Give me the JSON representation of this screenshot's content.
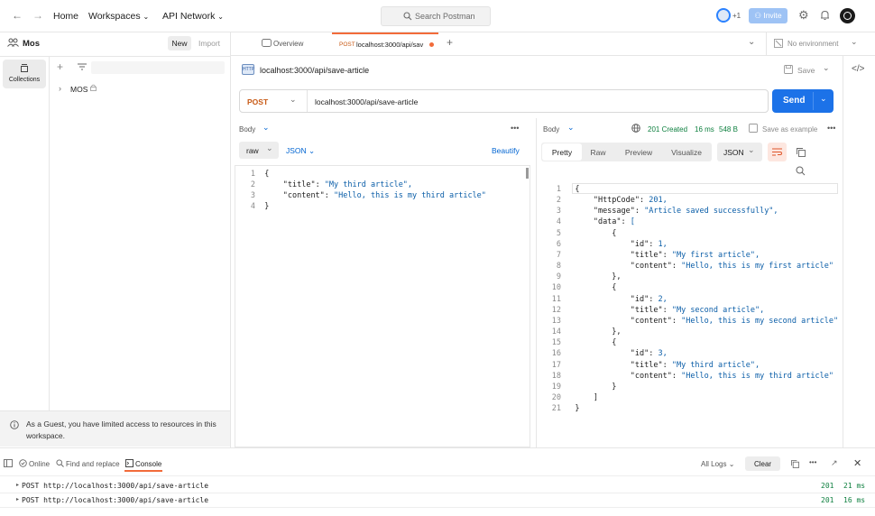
{
  "topbar": {
    "home": "Home",
    "workspaces": "Workspaces",
    "api_network": "API Network",
    "search_placeholder": "Search Postman",
    "plus_one": "+1",
    "invite": "Invite"
  },
  "sidebar": {
    "workspace_name": "Mos",
    "new_btn": "New",
    "import_btn": "Import",
    "collections_label": "Collections",
    "tree_item": "MOS",
    "guest_notice": "As a Guest, you have limited access to resources in this workspace."
  },
  "tabs": {
    "overview": "Overview",
    "active_method": "POST",
    "active_url": "localhost:3000/api/sav",
    "env": "No environment"
  },
  "request": {
    "title": "localhost:3000/api/save-article",
    "save": "Save",
    "method": "POST",
    "url": "localhost:3000/api/save-article",
    "send": "Send",
    "body_label": "Body",
    "raw": "raw",
    "json": "JSON",
    "beautify": "Beautify",
    "body_lines": [
      {
        "n": "1",
        "t": "{"
      },
      {
        "n": "2",
        "k": "\"title\"",
        "v": "\"My third article\","
      },
      {
        "n": "3",
        "k": "\"content\"",
        "v": "\"Hello, this is my third article\""
      },
      {
        "n": "4",
        "t": "}"
      }
    ]
  },
  "response": {
    "body_label": "Body",
    "status": "201 Created",
    "time": "16 ms",
    "size": "548 B",
    "save_example": "Save as example",
    "tabs": [
      "Pretty",
      "Raw",
      "Preview",
      "Visualize"
    ],
    "format": "JSON",
    "lines": [
      {
        "n": "1",
        "i": 0,
        "t": "{"
      },
      {
        "n": "2",
        "i": 1,
        "k": "\"HttpCode\"",
        "v": "201,"
      },
      {
        "n": "3",
        "i": 1,
        "k": "\"message\"",
        "v": "\"Article saved successfully\","
      },
      {
        "n": "4",
        "i": 1,
        "k": "\"data\"",
        "v": "["
      },
      {
        "n": "5",
        "i": 2,
        "t": "{"
      },
      {
        "n": "6",
        "i": 3,
        "k": "\"id\"",
        "v": "1,"
      },
      {
        "n": "7",
        "i": 3,
        "k": "\"title\"",
        "v": "\"My first article\","
      },
      {
        "n": "8",
        "i": 3,
        "k": "\"content\"",
        "v": "\"Hello, this is my first article\""
      },
      {
        "n": "9",
        "i": 2,
        "t": "},"
      },
      {
        "n": "10",
        "i": 2,
        "t": "{"
      },
      {
        "n": "11",
        "i": 3,
        "k": "\"id\"",
        "v": "2,"
      },
      {
        "n": "12",
        "i": 3,
        "k": "\"title\"",
        "v": "\"My second article\","
      },
      {
        "n": "13",
        "i": 3,
        "k": "\"content\"",
        "v": "\"Hello, this is my second article\""
      },
      {
        "n": "14",
        "i": 2,
        "t": "},"
      },
      {
        "n": "15",
        "i": 2,
        "t": "{"
      },
      {
        "n": "16",
        "i": 3,
        "k": "\"id\"",
        "v": "3,"
      },
      {
        "n": "17",
        "i": 3,
        "k": "\"title\"",
        "v": "\"My third article\","
      },
      {
        "n": "18",
        "i": 3,
        "k": "\"content\"",
        "v": "\"Hello, this is my third article\""
      },
      {
        "n": "19",
        "i": 2,
        "t": "}"
      },
      {
        "n": "20",
        "i": 1,
        "t": "]"
      },
      {
        "n": "21",
        "i": 0,
        "t": "}"
      }
    ]
  },
  "footer": {
    "online": "Online",
    "find_replace": "Find and replace",
    "console": "Console",
    "all_logs": "All Logs",
    "clear": "Clear"
  },
  "console_logs": [
    {
      "text": "POST http://localhost:3000/api/save-article",
      "status": "201",
      "time": "21 ms"
    },
    {
      "text": "POST http://localhost:3000/api/save-article",
      "status": "201",
      "time": "16 ms"
    }
  ]
}
